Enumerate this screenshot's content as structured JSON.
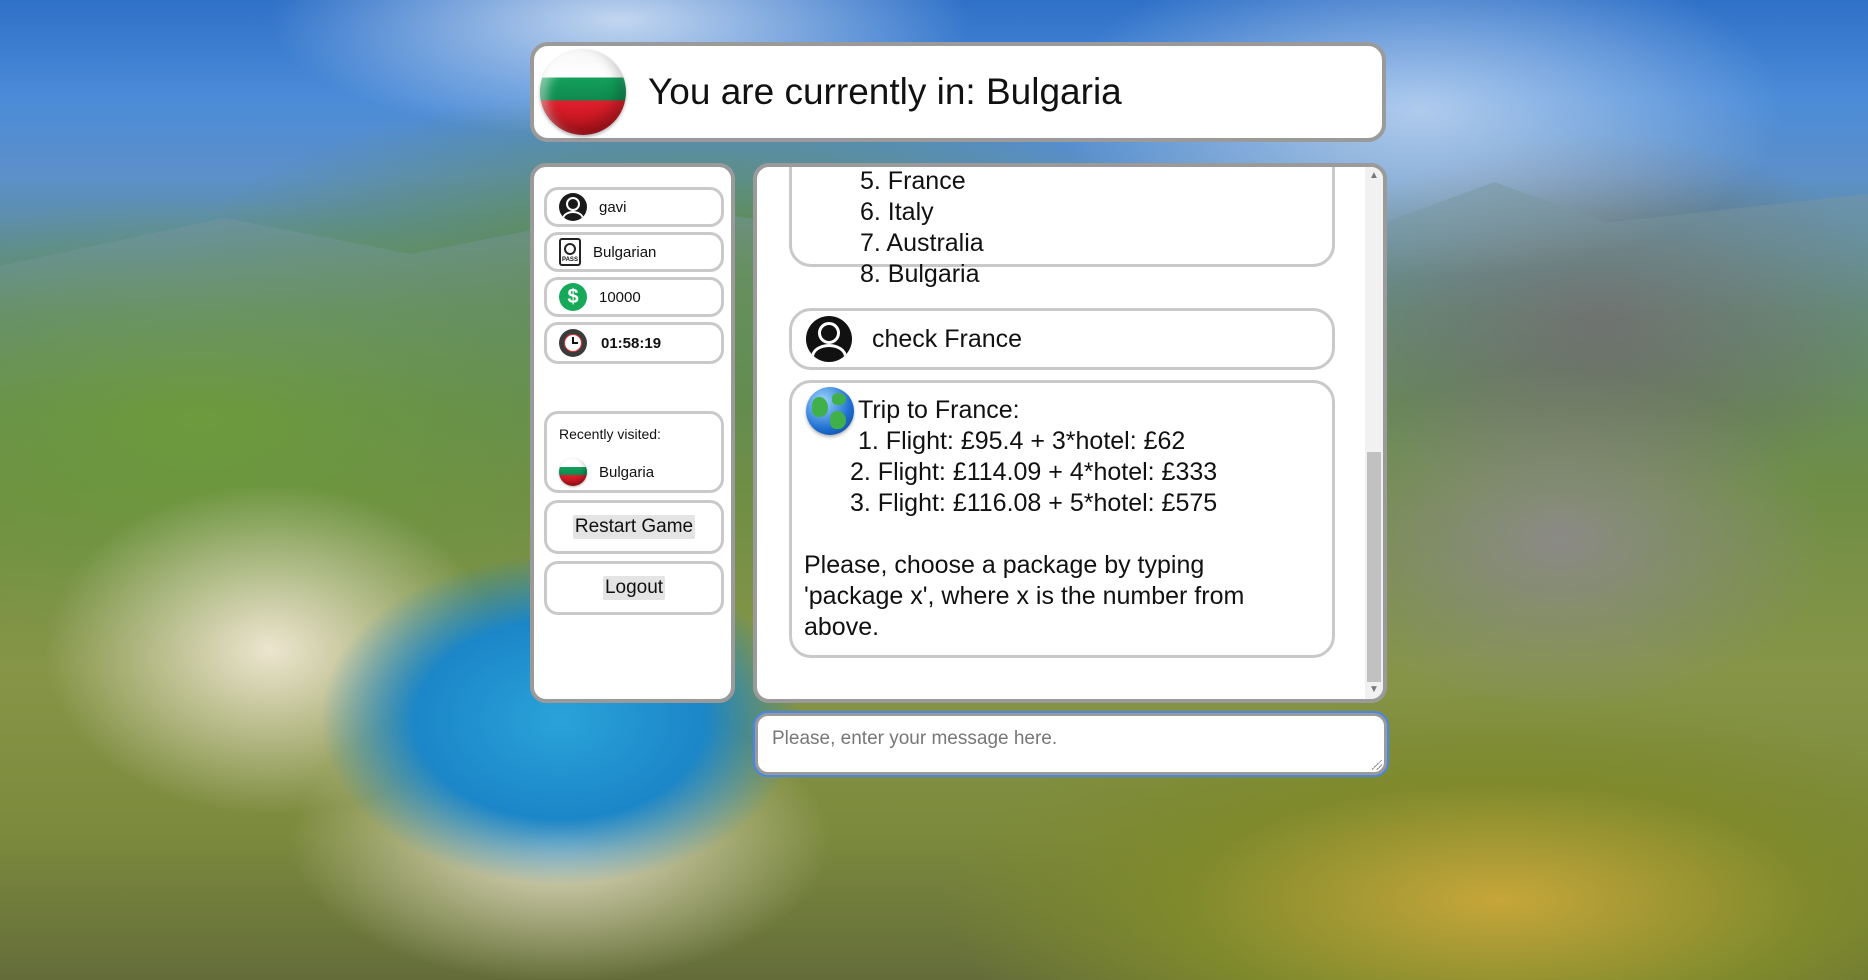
{
  "header": {
    "title": "You are currently in: Bulgaria",
    "flag_icon": "bulgaria-flag-icon"
  },
  "sidebar": {
    "username": "gavi",
    "nationality": "Bulgarian",
    "passport_label": "PASS",
    "money": "10000",
    "timer": "01:58:19",
    "recently_visited_label": "Recently visited:",
    "recently_visited": [
      {
        "name": "Bulgaria"
      }
    ],
    "restart_label": "Restart Game",
    "logout_label": "Logout"
  },
  "chat": {
    "destinations_partial": [
      "5. France",
      "6. Italy",
      "7. Australia",
      "8. Bulgaria"
    ],
    "user_message": "check France",
    "bot_message": {
      "title": "Trip to France:",
      "packages": [
        "1. Flight: £95.4 + 3*hotel: £62",
        "2. Flight: £114.09 + 4*hotel: £333",
        "3. Flight: £116.08 + 5*hotel: £575"
      ],
      "prompt_lines": [
        "Please, choose a package by typing",
        "'package x', where x is the number from",
        "above."
      ]
    }
  },
  "input": {
    "placeholder": "Please, enter your message here.",
    "value": ""
  },
  "colors": {
    "panel_border": "#9a9a9a",
    "bubble_border": "#c9c9c9",
    "money_green": "#17a95a",
    "focus_blue": "#4a86e8"
  }
}
